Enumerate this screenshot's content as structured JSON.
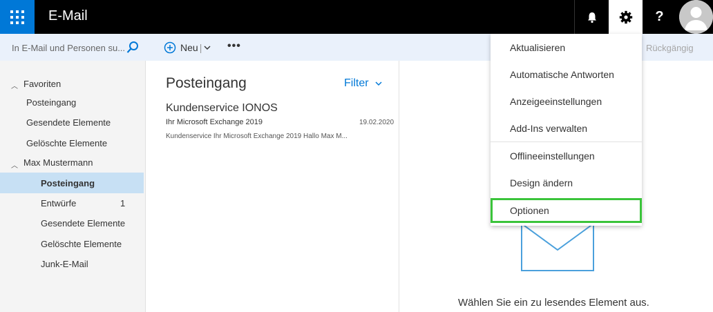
{
  "app": {
    "title": "E-Mail"
  },
  "search": {
    "placeholder": "In E-Mail und Personen su..."
  },
  "toolbar": {
    "new_label": "Neu",
    "new_separator": "|",
    "more_label": "•••",
    "undo_label": "Rückgängig"
  },
  "nav": {
    "favorites_label": "Favoriten",
    "favorites": [
      {
        "label": "Posteingang"
      },
      {
        "label": "Gesendete Elemente"
      },
      {
        "label": "Gelöschte Elemente"
      }
    ],
    "account_label": "Max Mustermann",
    "folders": [
      {
        "label": "Posteingang",
        "count": ""
      },
      {
        "label": "Entwürfe",
        "count": "1"
      },
      {
        "label": "Gesendete Elemente",
        "count": ""
      },
      {
        "label": "Gelöschte Elemente",
        "count": ""
      },
      {
        "label": "Junk-E-Mail",
        "count": ""
      }
    ]
  },
  "list": {
    "title": "Posteingang",
    "filter_label": "Filter",
    "mail": {
      "sender": "Kundenservice IONOS",
      "subject": "Ihr Microsoft Exchange 2019",
      "date": "19.02.2020",
      "preview": "Kundenservice Ihr Microsoft Exchange 2019 Hallo Max M..."
    }
  },
  "reading": {
    "empty_text": "Wählen Sie ein zu lesendes Element aus."
  },
  "settings_menu": {
    "items": [
      {
        "label": "Aktualisieren"
      },
      {
        "label": "Automatische Antworten"
      },
      {
        "label": "Anzeigeeinstellungen"
      },
      {
        "label": "Add-Ins verwalten"
      },
      {
        "label": "Offlineeinstellungen"
      },
      {
        "label": "Design ändern"
      },
      {
        "label": "Optionen"
      }
    ],
    "highlighted_index": 6
  },
  "icons": {
    "waffle": "app-launcher-icon",
    "bell": "bell-icon",
    "gear": "gear-icon",
    "help": "help-icon",
    "avatar": "avatar-icon",
    "search": "search-icon",
    "new": "plus-circle-icon",
    "envelope": "envelope-icon"
  },
  "colors": {
    "accent": "#0078d7",
    "highlight": "#3ac43a",
    "selected": "#c7e0f4"
  }
}
